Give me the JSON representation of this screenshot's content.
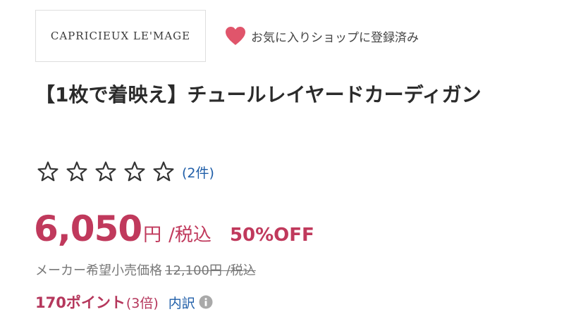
{
  "shop": {
    "logo_text": "CAPRICIEUX LE'MAGE",
    "favorite_label": "お気に入りショップに登録済み",
    "heart_color": "#e0556b"
  },
  "product": {
    "title": "【1枚で着映え】チュールレイヤードカーディガン",
    "rating": 0,
    "rating_max": 5,
    "review_count": "(2件)"
  },
  "price": {
    "value": "6,050",
    "yen": "円",
    "tax": "/税込",
    "discount": "50%OFF",
    "color": "#c0395c"
  },
  "msrp": {
    "label": "メーカー希望小売価格",
    "value": "12,100円 /税込"
  },
  "points": {
    "value": "170ポイント",
    "multiplier": "(3倍)",
    "breakdown_label": "内訳"
  },
  "icons": {
    "favorite": "heart-icon",
    "rating": "star-icon",
    "info": "info-icon"
  }
}
